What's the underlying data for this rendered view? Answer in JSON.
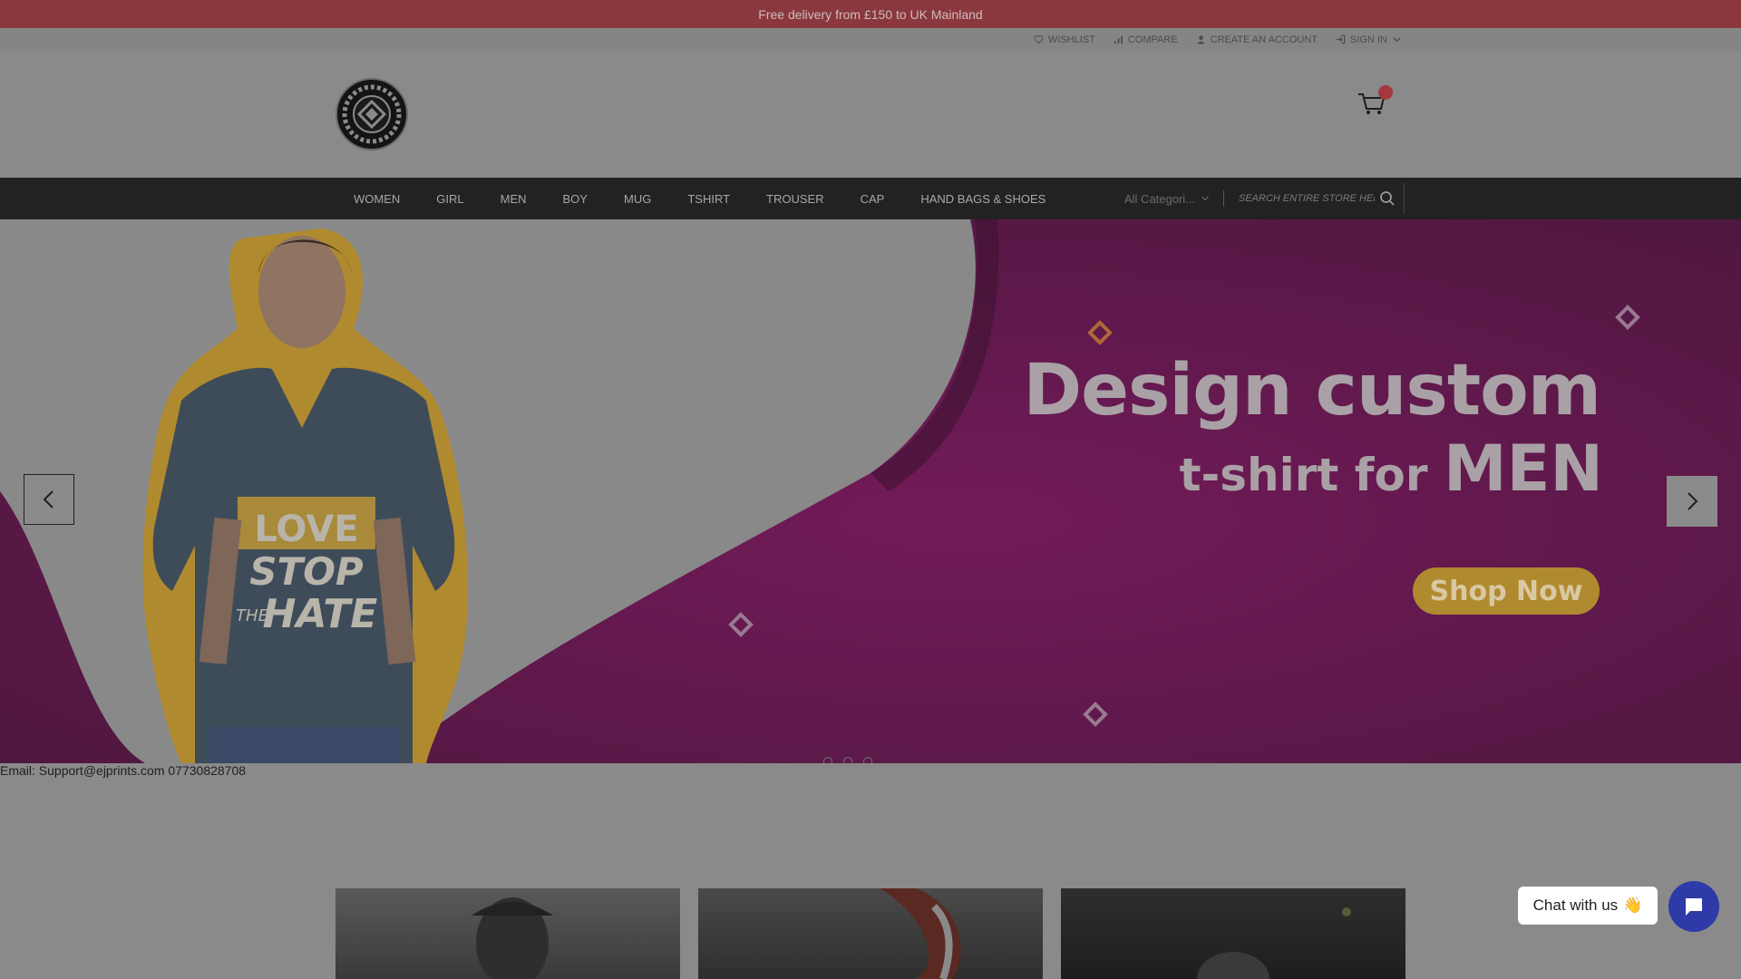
{
  "announcement": "Free delivery from £150 to UK Mainland",
  "util_links": [
    {
      "label": "WISHLIST",
      "icon": "heart-icon"
    },
    {
      "label": "COMPARE",
      "icon": "bar-chart-icon"
    },
    {
      "label": "CREATE AN ACCOUNT",
      "icon": "user-icon"
    },
    {
      "label": "SIGN IN",
      "icon": "sign-in-icon"
    }
  ],
  "nav": {
    "items": [
      "WOMEN",
      "GIRL",
      "MEN",
      "BOY",
      "MUG",
      "TSHIRT",
      "TROUSER",
      "CAP",
      "HAND BAGS & SHOES"
    ]
  },
  "search": {
    "category": "All Categori...",
    "placeholder": "Search entire store here..."
  },
  "hero": {
    "title": "Design custom",
    "subtitle_prefix": "t-shirt for",
    "subtitle_emphasis": "MEN",
    "button": "Shop Now",
    "shirt_line1": "LOVE",
    "shirt_line2": "STOP",
    "shirt_line3_small": "THE",
    "shirt_line3": "HATE",
    "active_slide": 1,
    "slide_count": 3
  },
  "contact": "Email: Support@ejprints.com 07730828708",
  "chat": {
    "label": "Chat with us",
    "emoji": "👋"
  },
  "colors": {
    "announcement_bg": "#8a383d",
    "nav_bg": "#222222",
    "hero_purple": "#6a1a52",
    "button_gold": "#b08a2e",
    "chat_blue": "#2e3aa8"
  }
}
